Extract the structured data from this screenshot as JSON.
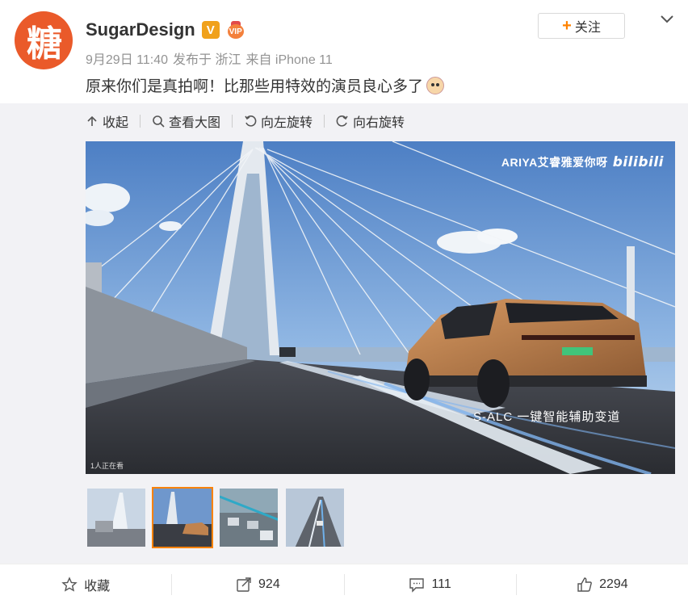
{
  "user": {
    "avatar_char": "糖",
    "name": "SugarDesign",
    "verified_badge": "V",
    "medal_text": "VIP"
  },
  "meta": {
    "date": "9月29日 11:40",
    "published_from": "发布于 浙江",
    "device": "来自 iPhone 11"
  },
  "post": {
    "text": "原来你们是真拍啊！比那些用特效的演员良心多了"
  },
  "follow_button": {
    "label": "关注"
  },
  "toolbar": {
    "collapse": "收起",
    "view_large": "查看大图",
    "rotate_left": "向左旋转",
    "rotate_right": "向右旋转"
  },
  "image": {
    "watermark_text": "ARIYA艾睿雅爱你呀",
    "watermark_logo": "bilibili",
    "caption": "S-ALC 一键智能辅助变道",
    "viewers": "1人正在看"
  },
  "thumbnails": [
    {
      "name": "thumb-1",
      "active": false
    },
    {
      "name": "thumb-2",
      "active": true
    },
    {
      "name": "thumb-3",
      "active": false
    },
    {
      "name": "thumb-4",
      "active": false
    }
  ],
  "footer": {
    "favorite": "收藏",
    "repost_count": "924",
    "comment_count": "111",
    "like_count": "2294"
  },
  "colors": {
    "accent": "#ff8200",
    "avatar_bg": "#ea5a2a",
    "muted_text": "#939393"
  }
}
